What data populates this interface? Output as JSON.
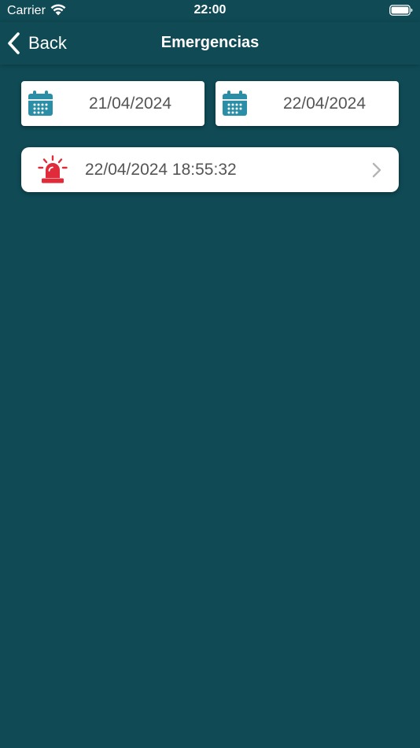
{
  "status_bar": {
    "carrier": "Carrier",
    "time": "22:00",
    "wifi_icon": "wifi-icon",
    "battery_icon": "battery-icon"
  },
  "nav": {
    "back_label": "Back",
    "title": "Emergencias",
    "back_icon": "chevron-left-icon"
  },
  "date_range": {
    "from": "21/04/2024",
    "to": "22/04/2024",
    "icon": "calendar-icon"
  },
  "emergencies": [
    {
      "datetime": "22/04/2024 18:55:32",
      "icon": "siren-icon"
    }
  ],
  "colors": {
    "background": "#0f4a55",
    "card": "#ffffff",
    "text": "#555555",
    "calendar": "#2a8fa6",
    "siren": "#e02b3a",
    "chevron": "#b5b5b5"
  }
}
